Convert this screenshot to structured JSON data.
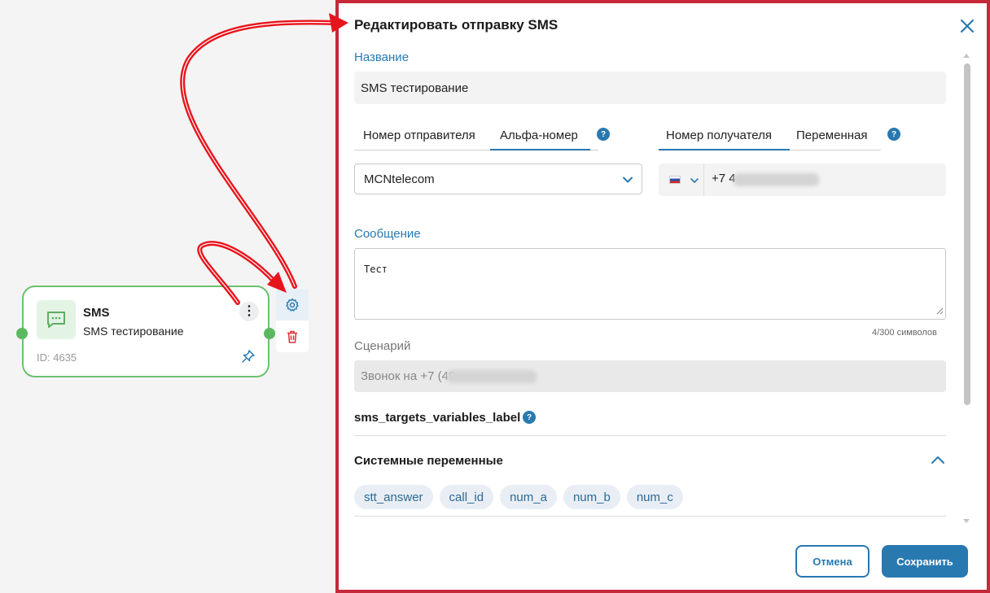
{
  "node": {
    "title": "SMS",
    "subtitle": "SMS тестирование",
    "id_label": "ID: 4635",
    "menu_glyph": "⋮"
  },
  "modal": {
    "title": "Редактировать отправку SMS",
    "name_label": "Название",
    "name_value": "SMS тестирование",
    "sender_tabs": [
      "Номер отправителя",
      "Альфа-номер"
    ],
    "recipient_tabs": [
      "Номер получателя",
      "Переменная"
    ],
    "help_glyph": "?",
    "sender_value": "MCNtelecom",
    "phone_prefix": "+7 4",
    "message_label": "Сообщение",
    "message_value": "Тест",
    "counter": "4/300 символов",
    "scenario_label": "Сценарий",
    "scenario_value": "Звонок на +7 (49",
    "targets_label": "sms_targets_variables_label",
    "system_vars_label": "Системные переменные",
    "chips": [
      "stt_answer",
      "call_id",
      "num_a",
      "num_b",
      "num_c"
    ],
    "cancel": "Отмена",
    "save": "Сохранить"
  },
  "icons": [
    "message-icon",
    "kebab-menu-icon",
    "pin-icon",
    "gear-icon",
    "trash-icon",
    "close-icon",
    "chevron-down-icon",
    "chevron-up-icon",
    "help-icon",
    "russia-flag-icon"
  ],
  "colors": {
    "accent": "#2879b0",
    "node_border": "#6cc070",
    "highlight_border": "#c7283a",
    "arrow": "#e8141c"
  }
}
